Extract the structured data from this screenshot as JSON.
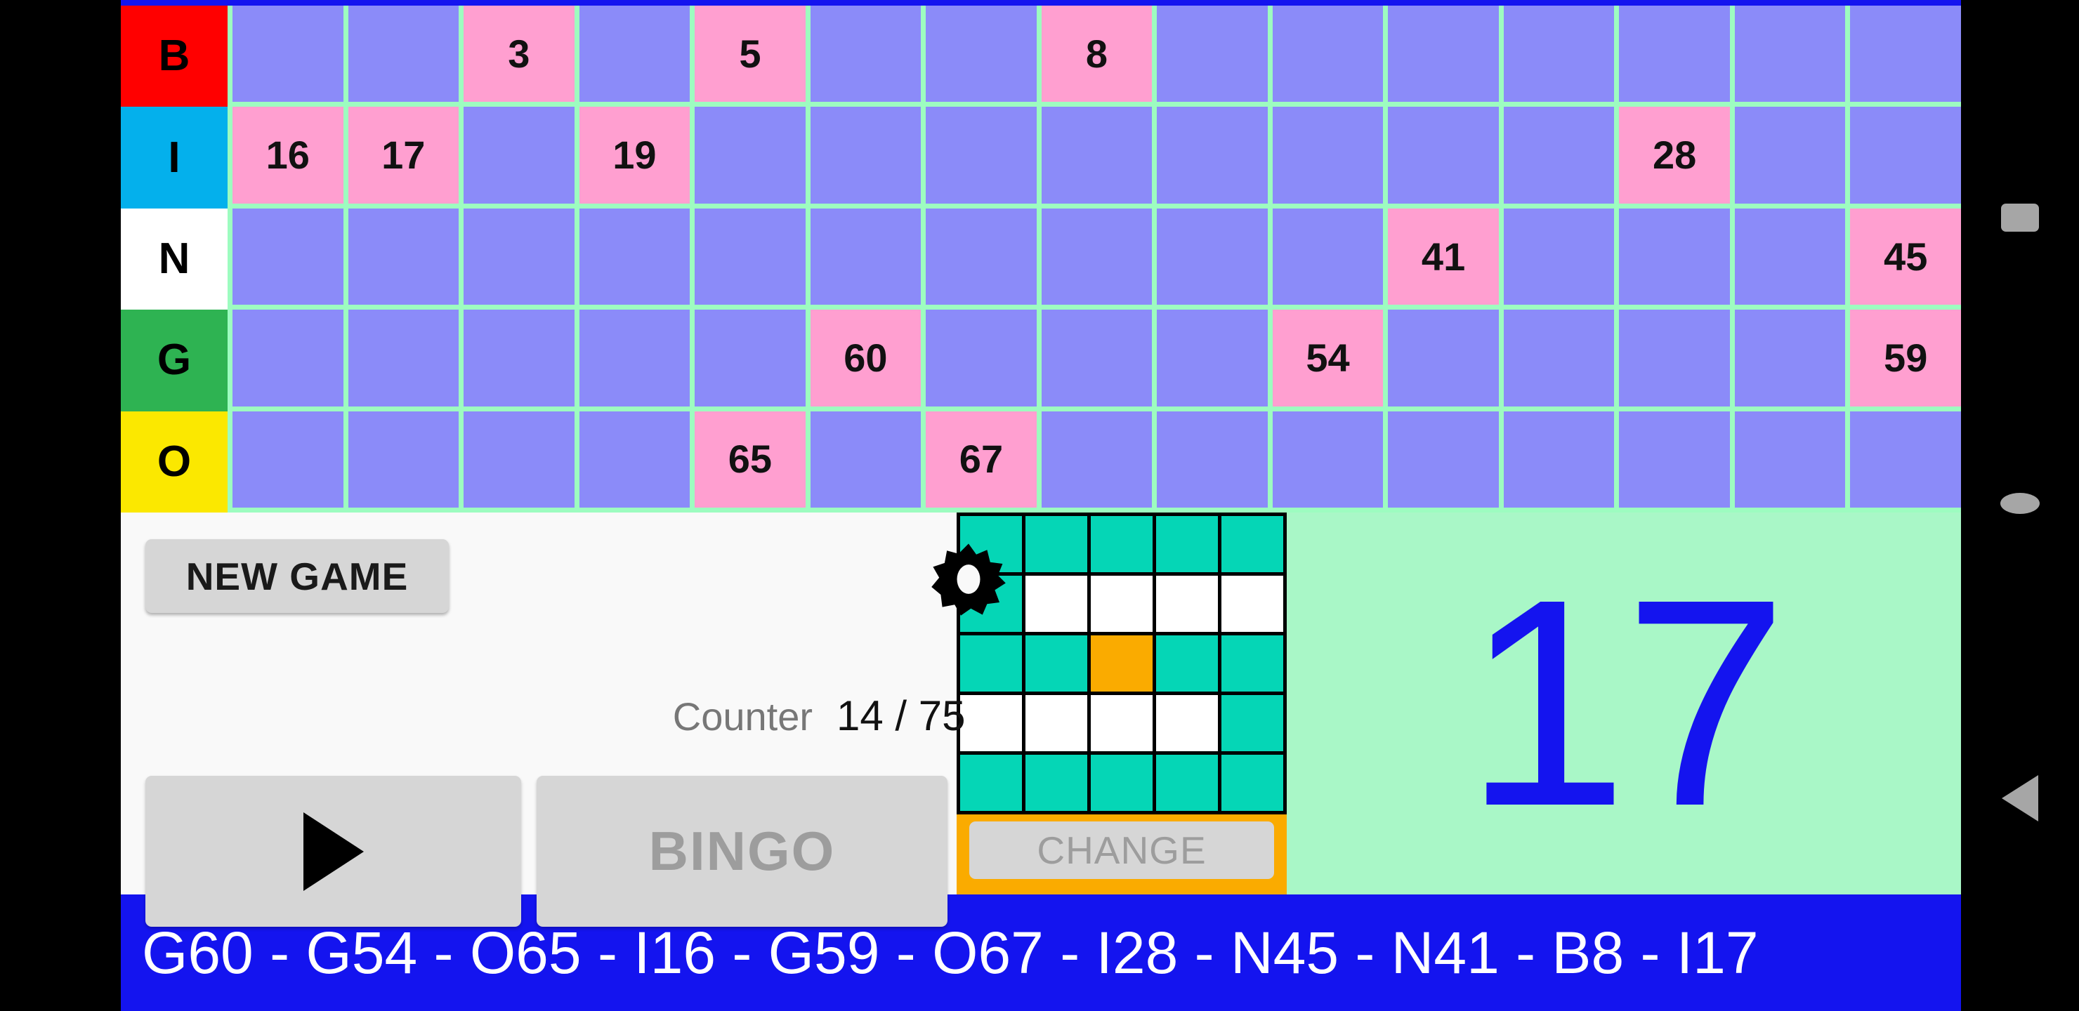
{
  "board": {
    "rows": [
      {
        "letter": "B",
        "letter_color": "#ff0000",
        "cells": [
          "",
          "",
          "3",
          "",
          "5",
          "",
          "",
          "8",
          "",
          "",
          "",
          "",
          "",
          "",
          ""
        ]
      },
      {
        "letter": "I",
        "letter_color": "#04b0ec",
        "cells": [
          "16",
          "17",
          "",
          "19",
          "",
          "",
          "",
          "",
          "",
          "",
          "",
          "",
          "28",
          "",
          ""
        ]
      },
      {
        "letter": "N",
        "letter_color": "#ffffff",
        "cells": [
          "",
          "",
          "",
          "",
          "",
          "",
          "",
          "",
          "",
          "",
          "41",
          "",
          "",
          "",
          "45"
        ]
      },
      {
        "letter": "G",
        "letter_color": "#2eb352",
        "cells": [
          "",
          "",
          "",
          "",
          "",
          "60",
          "",
          "",
          "",
          "54",
          "",
          "",
          "",
          "",
          "59"
        ]
      },
      {
        "letter": "O",
        "letter_color": "#fbe800",
        "cells": [
          "",
          "",
          "",
          "",
          "65",
          "",
          "67",
          "",
          "",
          "",
          "",
          "",
          "",
          "",
          ""
        ]
      }
    ],
    "colors": {
      "grid_line": "#9dfcc0",
      "cell_unmarked": "#8b8bf9",
      "cell_marked": "#ff9fd0"
    }
  },
  "controls": {
    "new_game_label": "NEW GAME",
    "settings_icon": "gear-icon",
    "counter_label": "Counter",
    "counter_value": "14 / 75",
    "play_icon": "play-triangle-icon",
    "bingo_label": "BINGO"
  },
  "pattern": {
    "change_label": "CHANGE",
    "colors": {
      "on": "#05d6b6",
      "off": "#ffffff",
      "center": "#faab00",
      "frame": "#faab00"
    },
    "cells": [
      [
        "on",
        "on",
        "on",
        "on",
        "on"
      ],
      [
        "on",
        "off",
        "off",
        "off",
        "off"
      ],
      [
        "on",
        "on",
        "center",
        "on",
        "on"
      ],
      [
        "off",
        "off",
        "off",
        "off",
        "on"
      ],
      [
        "on",
        "on",
        "on",
        "on",
        "on"
      ]
    ]
  },
  "current_number": {
    "value": "17",
    "text_color": "#1414ef",
    "background_color": "#a9f7c7"
  },
  "history": {
    "text": "G60 - G54 - O65 - I16 - G59 - O67 - I28 - N45 - N41 -  B8 - I17",
    "background_color": "#1414ef"
  },
  "navbar": {
    "recents_icon": "square-recents-icon",
    "home_icon": "circle-home-icon",
    "back_icon": "triangle-back-icon"
  }
}
